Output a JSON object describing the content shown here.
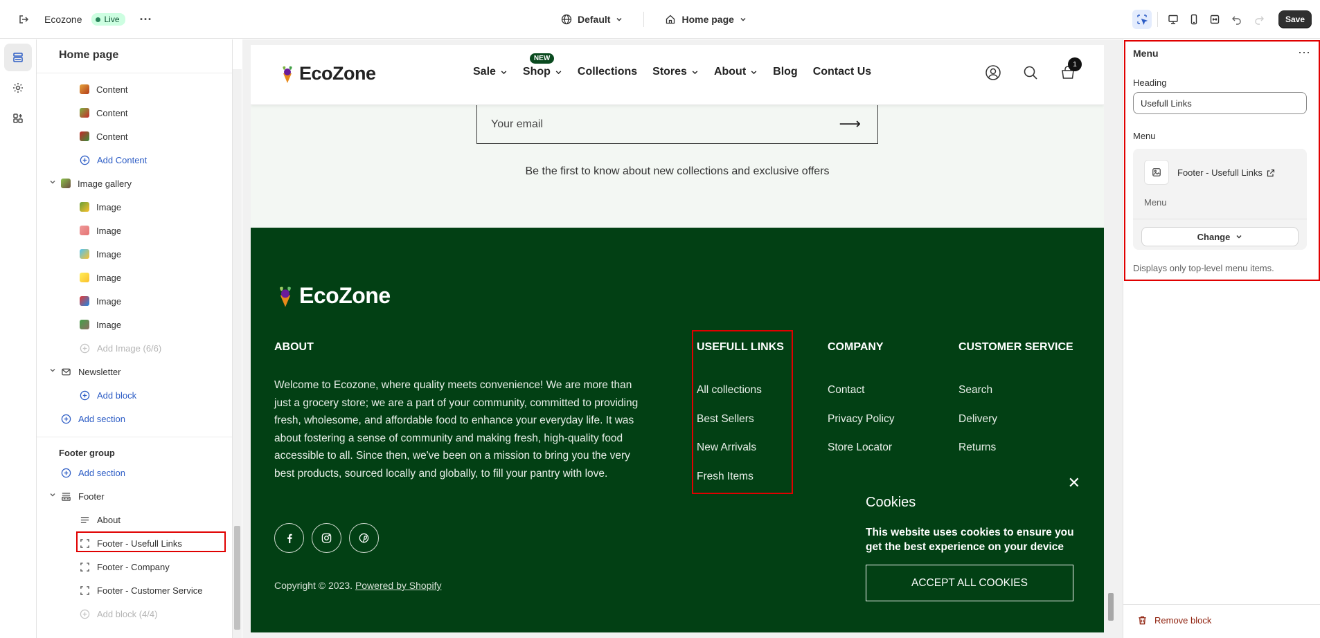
{
  "topbar": {
    "store_name": "Ecozone",
    "status_badge": "Live",
    "theme_select": "Default",
    "page_select": "Home page",
    "save_label": "Save"
  },
  "sidebar": {
    "title": "Home page",
    "items": [
      {
        "label": "Content",
        "type": "block"
      },
      {
        "label": "Content",
        "type": "block"
      },
      {
        "label": "Content",
        "type": "block"
      },
      {
        "label": "Add Content",
        "type": "add"
      },
      {
        "label": "Image gallery",
        "type": "section"
      },
      {
        "label": "Image",
        "type": "block"
      },
      {
        "label": "Image",
        "type": "block"
      },
      {
        "label": "Image",
        "type": "block"
      },
      {
        "label": "Image",
        "type": "block"
      },
      {
        "label": "Image",
        "type": "block"
      },
      {
        "label": "Image",
        "type": "block"
      },
      {
        "label": "Add Image (6/6)",
        "type": "disabled"
      },
      {
        "label": "Newsletter",
        "type": "section"
      },
      {
        "label": "Add block",
        "type": "add"
      },
      {
        "label": "Add section",
        "type": "add"
      }
    ],
    "footer_group": {
      "title": "Footer group",
      "add_section": "Add section",
      "footer_label": "Footer",
      "blocks": [
        "About",
        "Footer - Usefull Links",
        "Footer - Company",
        "Footer - Customer Service"
      ],
      "add_block_disabled": "Add block (4/4)"
    }
  },
  "preview": {
    "header": {
      "logo_text": "EcoZone",
      "nav": [
        "Sale",
        "Shop",
        "Collections",
        "Stores",
        "About",
        "Blog",
        "Contact Us"
      ],
      "new_badge": "NEW",
      "cart_count": "1"
    },
    "newsletter": {
      "email_placeholder": "Your email",
      "subtext": "Be the first to know about new collections and exclusive offers"
    },
    "footer": {
      "logo_text": "EcoZone",
      "about_heading": "ABOUT",
      "about_text": "Welcome to Ecozone, where quality meets convenience! We are more than just a grocery store; we are a part of your community, committed to providing fresh, wholesome, and affordable food to enhance your everyday life. It was about fostering a sense of community and making fresh, high-quality food accessible to all. Since then, we've been on a mission to bring you the very best products, sourced locally and globally, to fill your pantry with love.",
      "useful_heading": "USEFULL LINKS",
      "useful_links": [
        "All collections",
        "Best Sellers",
        "New Arrivals",
        "Fresh Items"
      ],
      "company_heading": "COMPANY",
      "company_links": [
        "Contact",
        "Privacy Policy",
        "Store Locator"
      ],
      "service_heading": "CUSTOMER SERVICE",
      "service_links": [
        "Search",
        "Delivery",
        "Returns"
      ],
      "copyright_prefix": "Copyright © 2023.",
      "copyright_link": "Powered by Shopify"
    },
    "cookie": {
      "title": "Cookies",
      "text": "This website uses cookies to ensure you get the best experience on your device",
      "button": "ACCEPT ALL COOKIES"
    }
  },
  "right_panel": {
    "title": "Menu",
    "heading_label": "Heading",
    "heading_value": "Usefull Links",
    "menu_label": "Menu",
    "menu_name": "Footer - Usefull Links",
    "menu_sub": "Menu",
    "change_label": "Change",
    "help_text": "Displays only top-level menu items.",
    "remove_label": "Remove block"
  },
  "colors": {
    "footer_bg": "#024014",
    "accent_blue": "#2c5cc5",
    "highlight_red": "#e00000"
  }
}
